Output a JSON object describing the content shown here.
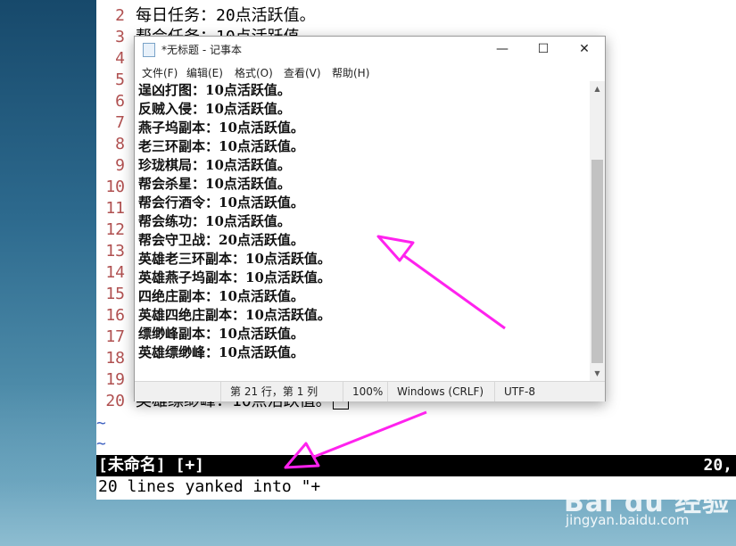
{
  "vim": {
    "lines": [
      {
        "num": "2",
        "text": "每日任务：20点活跃值。"
      },
      {
        "num": "3",
        "text": "帮会任务：10点活跃值。"
      },
      {
        "num": "4",
        "text": ""
      },
      {
        "num": "5",
        "text": ""
      },
      {
        "num": "6",
        "text": ""
      },
      {
        "num": "7",
        "text": ""
      },
      {
        "num": "8",
        "text": ""
      },
      {
        "num": "9",
        "text": ""
      },
      {
        "num": "10",
        "text": ""
      },
      {
        "num": "11",
        "text": ""
      },
      {
        "num": "12",
        "text": ""
      },
      {
        "num": "13",
        "text": ""
      },
      {
        "num": "14",
        "text": ""
      },
      {
        "num": "15",
        "text": ""
      },
      {
        "num": "16",
        "text": ""
      },
      {
        "num": "17",
        "text": ""
      },
      {
        "num": "18",
        "text": ""
      },
      {
        "num": "19",
        "text": ""
      },
      {
        "num": "20",
        "text": "英雄缥缈峰：10点活跃值。"
      }
    ],
    "tilde": "~",
    "status_left": "[未命名] [+]",
    "status_right": "20,",
    "command_line": "20 lines yanked into \"+"
  },
  "notepad": {
    "title": "*无标题 - 记事本",
    "window_buttons": {
      "minimize": "—",
      "maximize": "☐",
      "close": "✕"
    },
    "menu": [
      "文件(F)",
      "编辑(E)",
      "格式(O)",
      "查看(V)",
      "帮助(H)"
    ],
    "lines": [
      "逞凶打图：10点活跃值。",
      "反贼入侵：10点活跃值。",
      "燕子坞副本：10点活跃值。",
      "老三环副本：10点活跃值。",
      "珍珑棋局：10点活跃值。",
      "帮会杀星：10点活跃值。",
      "帮会行酒令：10点活跃值。",
      "帮会练功：10点活跃值。",
      "帮会守卫战：20点活跃值。",
      "英雄老三环副本：10点活跃值。",
      "英雄燕子坞副本：10点活跃值。",
      "四绝庄副本：10点活跃值。",
      "英雄四绝庄副本：10点活跃值。",
      "缥缈峰副本：10点活跃值。",
      "英雄缥缈峰：10点活跃值。"
    ],
    "status": {
      "position": "第 21 行，第 1 列",
      "zoom": "100%",
      "line_ending": "Windows (CRLF)",
      "encoding": "UTF-8"
    }
  },
  "watermark": {
    "brand": "Bai du 经验",
    "url": "jingyan.baidu.com"
  },
  "colors": {
    "arrow": "#ff22ee",
    "line_number": "#b05050",
    "tilde": "#3b5fc0"
  },
  "icons": [
    "notepad-icon",
    "minimize-icon",
    "maximize-icon",
    "close-icon",
    "arrow-up-icon",
    "arrow-down-icon",
    "annotation-arrow"
  ]
}
